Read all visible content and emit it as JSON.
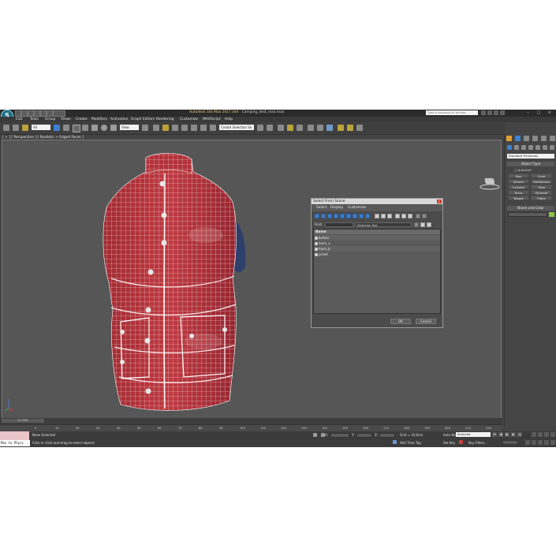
{
  "window": {
    "title": "Autodesk 3ds Max 2017 x64",
    "filename": "Camping_Vest_max.max"
  },
  "search": {
    "placeholder": "Type a keyword or phrase"
  },
  "menu": [
    "Edit",
    "Tools",
    "Group",
    "Views",
    "Create",
    "Modifiers",
    "Animation",
    "Graph Editors",
    "Rendering",
    "Customize",
    "MAXScript",
    "Help"
  ],
  "toolbar": {
    "filter": "All",
    "view": "View",
    "selection_set": "Create Selection Se"
  },
  "viewport": {
    "label": "[ + ] [ Perspective ] [ Realistic + Edged Faces ]"
  },
  "command_panel": {
    "category": "Standard Primitives",
    "object_type_title": "Object Type",
    "autogrid": "AutoGrid",
    "buttons": [
      "Box",
      "Cone",
      "Sphere",
      "GeoSphere",
      "Cylinder",
      "Tube",
      "Torus",
      "Pyramid",
      "Teapot",
      "Plane"
    ],
    "name_color_title": "Name and Color"
  },
  "dialog": {
    "title": "Select From Scene",
    "menu": [
      "Select",
      "Display",
      "Customize"
    ],
    "find_label": "Find:",
    "selection_set": "Selection Set:",
    "column_name": "Name",
    "items": [
      "button",
      "foam_a",
      "foam_b",
      "jacket"
    ],
    "ok": "OK",
    "cancel": "Cancel"
  },
  "timeline": {
    "frame": "0 / 225",
    "ticks": [
      "0",
      "10",
      "20",
      "30",
      "40",
      "50",
      "60",
      "70",
      "80",
      "90",
      "100",
      "110",
      "120",
      "130",
      "140",
      "150",
      "160",
      "170",
      "180",
      "190",
      "200",
      "210",
      "220"
    ]
  },
  "status": {
    "script": "Max to Physc",
    "none_selected": "None Selected",
    "prompt": "Click or click-and-drag to select objects",
    "grid": "Grid = 10,0cm",
    "add_time_tag": "Add Time Tag",
    "auto_key": "Auto Key",
    "set_key": "Set Key",
    "selected": "Selected",
    "key_filters": "Key Filters..."
  },
  "colors": {
    "vest": "#b8333a",
    "wire": "#ffffff",
    "viewport_bg": "#565656",
    "accent": "#3b7fd0"
  }
}
